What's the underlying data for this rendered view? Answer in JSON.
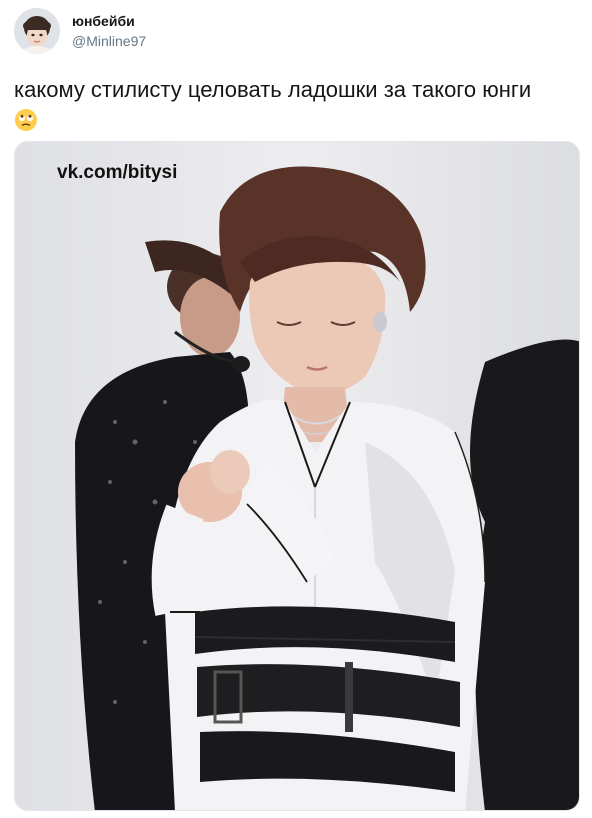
{
  "tweet": {
    "display_name": "юнбейби",
    "handle": "@Minline97",
    "text": "какому стилисту целовать ладошки за такого юнги",
    "emoji": "rolling-eyes-face-emoji"
  },
  "media": {
    "watermark": "vk.com/bitysi",
    "colors": {
      "background_wall": "#e8e9ec",
      "shirt_white": "#f4f4f6",
      "belt_black": "#1b1b1d",
      "hair_brown": "#5a3328",
      "sequin_jacket": "#16161a"
    }
  }
}
